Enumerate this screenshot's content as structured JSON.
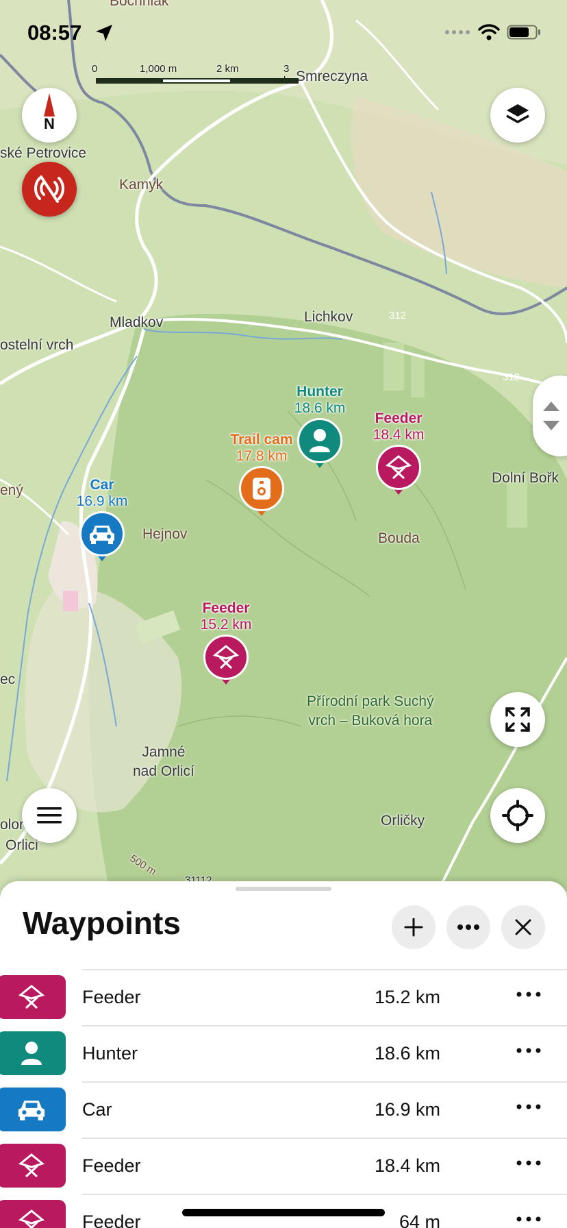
{
  "status_bar": {
    "time": "08:57"
  },
  "scale_bar": {
    "labels": [
      "0",
      "1,000 m",
      "2 km",
      "3 km"
    ]
  },
  "compass": {
    "label": "N"
  },
  "map_labels": {
    "bochniak": "Bochniak",
    "smreczyna": "Smreczyna",
    "petrovice": "ské Petrovice",
    "kamyk": "Kamyk",
    "mladkov": "Mladkov",
    "lichkov": "Lichkov",
    "road312a": "312",
    "road312b": "312",
    "kostelni": "ostelní vrch",
    "dolni_borik": "Dolní Bořk",
    "eny": "ený",
    "hejnov": "Hejnov",
    "bouda": "Bouda",
    "ec": "ec",
    "park": "Přírodní park Suchý\nvrch – Buková hora",
    "jamne": "Jamné\nnad Orlicí",
    "orlicky": "Orličky",
    "olor": "olor",
    "orlici": "Orlici",
    "elev500": "500 m",
    "elev31112": "31112"
  },
  "markers": [
    {
      "name": "Hunter",
      "distance": "18.6 km",
      "color": "#0f8a7c"
    },
    {
      "name": "Feeder",
      "distance": "18.4 km",
      "color": "#b8195f"
    },
    {
      "name": "Trail cam",
      "distance": "17.8 km",
      "color": "#e46d1c"
    },
    {
      "name": "Car",
      "distance": "16.9 km",
      "color": "#1679c4"
    },
    {
      "name": "Feeder",
      "distance": "15.2 km",
      "color": "#b8195f"
    }
  ],
  "sheet": {
    "title": "Waypoints",
    "rows": [
      {
        "name": "Feeder",
        "distance": "15.2 km",
        "icon": "feeder-icon",
        "color": "#b8195f"
      },
      {
        "name": "Hunter",
        "distance": "18.6 km",
        "icon": "hunter-icon",
        "color": "#0f8a7c"
      },
      {
        "name": "Car",
        "distance": "16.9 km",
        "icon": "car-icon",
        "color": "#1679c4"
      },
      {
        "name": "Feeder",
        "distance": "18.4 km",
        "icon": "feeder-icon",
        "color": "#b8195f"
      },
      {
        "name": "Feeder",
        "distance": "64 m",
        "icon": "feeder-icon",
        "color": "#b8195f"
      }
    ]
  }
}
